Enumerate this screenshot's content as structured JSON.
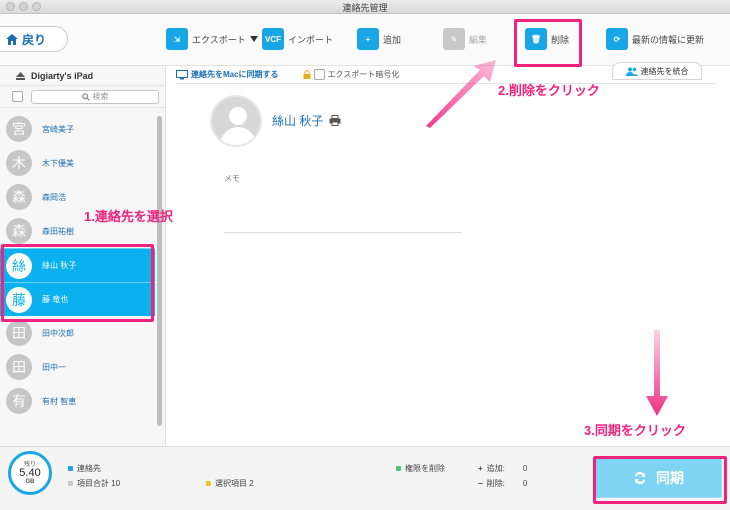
{
  "window": {
    "title": "連絡先管理"
  },
  "toolbar": {
    "back_label": "戻り",
    "export_label": "エクスポート",
    "export_icon_text": "⇲",
    "import_label": "インポート",
    "import_icon_text": "VCF",
    "add_label": "追加",
    "add_icon_text": "+",
    "edit_label": "編集",
    "edit_icon_text": "✎",
    "delete_label": "削除",
    "delete_icon_text": "🗑",
    "refresh_label": "最新の情報に更新",
    "refresh_icon_text": "⟳"
  },
  "sidebar": {
    "device_name": "Digiarty's iPad",
    "search_placeholder": "検索",
    "contacts": [
      {
        "initial": "宮",
        "name": "宮崎美子",
        "selected": false
      },
      {
        "initial": "木",
        "name": "木下優美",
        "selected": false
      },
      {
        "initial": "森",
        "name": "森岡浩",
        "selected": false
      },
      {
        "initial": "森",
        "name": "森田祐樹",
        "selected": false
      },
      {
        "initial": "絲",
        "name": "絲山 秋子",
        "selected": true
      },
      {
        "initial": "藤",
        "name": "藤 竜也",
        "selected": true
      },
      {
        "initial": "田",
        "name": "田中次郎",
        "selected": false
      },
      {
        "initial": "田",
        "name": "田中一",
        "selected": false
      },
      {
        "initial": "有",
        "name": "有村 智恵",
        "selected": false
      }
    ]
  },
  "subbar": {
    "sync_mac_label": "連絡先をMacに同期する",
    "encrypt_label": "エクスポート暗号化",
    "merge_label": "連絡先を統合"
  },
  "detail": {
    "name": "絲山 秋子",
    "memo_label": "メモ"
  },
  "bottom": {
    "storage_label": "残り",
    "storage_value": "5.40",
    "storage_unit": "GB",
    "legend_contacts": "連絡先",
    "total_items": "項目合計 10",
    "selected_items": "選択項目 2",
    "delete_permission": "権限を削除",
    "added_label": "追加:",
    "added_value": "0",
    "deleted_label": "削除:",
    "deleted_value": "0",
    "sync_label": "同期"
  },
  "annotations": {
    "step1": "1.連絡先を選択",
    "step2": "2.削除をクリック",
    "step3": "3.同期をクリック"
  },
  "colors": {
    "accent": "#19a6e6",
    "selected_row": "#0bb0ee",
    "annotation": "#f0237d"
  }
}
